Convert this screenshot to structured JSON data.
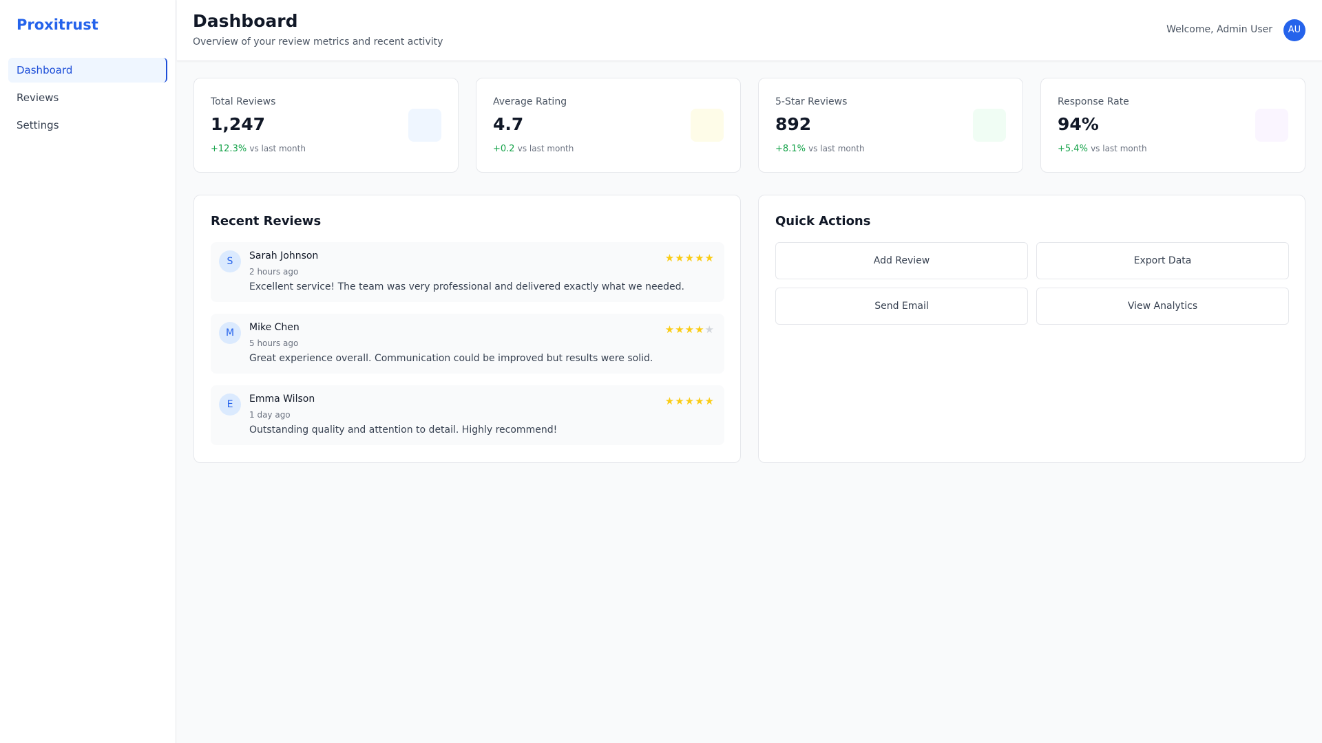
{
  "sidebar": {
    "brand": "Proxitrust",
    "items": [
      {
        "label": "Dashboard",
        "active": true
      },
      {
        "label": "Reviews",
        "active": false
      },
      {
        "label": "Settings",
        "active": false
      }
    ]
  },
  "header": {
    "title": "Dashboard",
    "subtitle": "Overview of your review metrics and recent activity",
    "welcome": "Welcome, Admin User",
    "avatar_initials": "AU"
  },
  "stats": [
    {
      "label": "Total Reviews",
      "value": "1,247",
      "change": "+12.3%",
      "change_label": "vs last month",
      "icon_color": "#eff6ff"
    },
    {
      "label": "Average Rating",
      "value": "4.7",
      "change": "+0.2",
      "change_label": "vs last month",
      "icon_color": "#fefce8"
    },
    {
      "label": "5-Star Reviews",
      "value": "892",
      "change": "+8.1%",
      "change_label": "vs last month",
      "icon_color": "#f0fdf4"
    },
    {
      "label": "Response Rate",
      "value": "94%",
      "change": "+5.4%",
      "change_label": "vs last month",
      "icon_color": "#faf5ff"
    }
  ],
  "recent_reviews": {
    "title": "Recent Reviews",
    "items": [
      {
        "initial": "S",
        "name": "Sarah Johnson",
        "time": "2 hours ago",
        "text": "Excellent service! The team was very professional and delivered exactly what we needed.",
        "rating": 5
      },
      {
        "initial": "M",
        "name": "Mike Chen",
        "time": "5 hours ago",
        "text": "Great experience overall. Communication could be improved but results were solid.",
        "rating": 4
      },
      {
        "initial": "E",
        "name": "Emma Wilson",
        "time": "1 day ago",
        "text": "Outstanding quality and attention to detail. Highly recommend!",
        "rating": 5
      }
    ]
  },
  "quick_actions": {
    "title": "Quick Actions",
    "buttons": [
      "Add Review",
      "Export Data",
      "Send Email",
      "View Analytics"
    ]
  },
  "colors": {
    "accent": "#2563eb",
    "positive": "#16a34a",
    "star": "#facc15",
    "star_empty": "#d1d5db"
  }
}
